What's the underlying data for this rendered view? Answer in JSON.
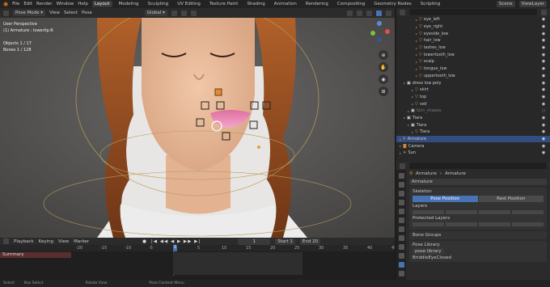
{
  "topbar": {
    "menus": [
      "File",
      "Edit",
      "Render",
      "Window",
      "Help"
    ],
    "workspaces": [
      "Layout",
      "Modeling",
      "Sculpting",
      "UV Editing",
      "Texture Paint",
      "Shading",
      "Animation",
      "Rendering",
      "Compositing",
      "Geometry Nodes",
      "Scripting"
    ],
    "active_workspace": "Layout",
    "scene": "Scene",
    "view_layer": "ViewLayer"
  },
  "viewport_header": {
    "mode": "Pose Mode",
    "menus": [
      "View",
      "Select",
      "Pose"
    ],
    "transform": "Global"
  },
  "viewport": {
    "info_lines": [
      "User Perspective",
      "(1) Armature : lowerlip.R",
      "",
      "Objects   1 / 17",
      "Bones     1 / 128"
    ]
  },
  "outliner": {
    "rows": [
      {
        "name": "eye_left",
        "indent": 4,
        "icon": "mesh",
        "vis": true
      },
      {
        "name": "eye_right",
        "indent": 4,
        "icon": "mesh",
        "vis": true
      },
      {
        "name": "eyeside_low",
        "indent": 4,
        "icon": "mesh",
        "vis": true
      },
      {
        "name": "hair_low",
        "indent": 4,
        "icon": "mesh",
        "vis": true
      },
      {
        "name": "lashes_low",
        "indent": 4,
        "icon": "mesh",
        "vis": true
      },
      {
        "name": "lowertooth_low",
        "indent": 4,
        "icon": "mesh",
        "vis": true
      },
      {
        "name": "scalp",
        "indent": 4,
        "icon": "mesh",
        "vis": true
      },
      {
        "name": "tongue_low",
        "indent": 4,
        "icon": "mesh",
        "vis": true
      },
      {
        "name": "uppertooth_low",
        "indent": 4,
        "icon": "mesh",
        "vis": true
      },
      {
        "name": "dress low poly",
        "indent": 1,
        "icon": "collection",
        "vis": true
      },
      {
        "name": "skirt",
        "indent": 3,
        "icon": "mesh",
        "vis": true
      },
      {
        "name": "top",
        "indent": 3,
        "icon": "mesh",
        "vis": true
      },
      {
        "name": "veil",
        "indent": 3,
        "icon": "mesh",
        "vis": true
      },
      {
        "name": "Skin_shapes",
        "indent": 2,
        "icon": "collection",
        "vis": false
      },
      {
        "name": "Tiara",
        "indent": 1,
        "icon": "collection",
        "vis": true
      },
      {
        "name": "Tiara",
        "indent": 2,
        "icon": "collection",
        "vis": true
      },
      {
        "name": "Tiara",
        "indent": 3,
        "icon": "mesh",
        "vis": true
      },
      {
        "name": "Armature",
        "indent": 0,
        "icon": "armature",
        "vis": true,
        "selected": true
      },
      {
        "name": "Camera",
        "indent": 0,
        "icon": "camera",
        "vis": true
      },
      {
        "name": "Sun",
        "indent": 0,
        "icon": "light",
        "vis": true
      }
    ]
  },
  "properties": {
    "breadcrumb": [
      "Armature",
      "Armature"
    ],
    "datablock": "Armature",
    "skeleton_label": "Skeleton",
    "pose_position": "Pose Position",
    "rest_position": "Rest Position",
    "layers_label": "Layers",
    "protected_label": "Protected Layers",
    "sections": [
      "Bone Groups",
      "Pose Library"
    ],
    "pose_lib_item": "pose library",
    "pose_lib_item2": "BriddleEyeClosed"
  },
  "timeline": {
    "menus": [
      "Playback",
      "Keying",
      "View",
      "Marker"
    ],
    "current_frame": "1",
    "start_label": "Start",
    "start": "1",
    "end_label": "End",
    "end": "20",
    "ticks": [
      "-20",
      "-15",
      "-10",
      "-5",
      "0",
      "5",
      "10",
      "15",
      "20",
      "25",
      "30",
      "35",
      "40",
      "45"
    ],
    "channel": "Summary"
  },
  "statusbar": {
    "items": [
      "Select",
      "Box Select",
      "Rotate View",
      "Pose Context Menu"
    ]
  }
}
